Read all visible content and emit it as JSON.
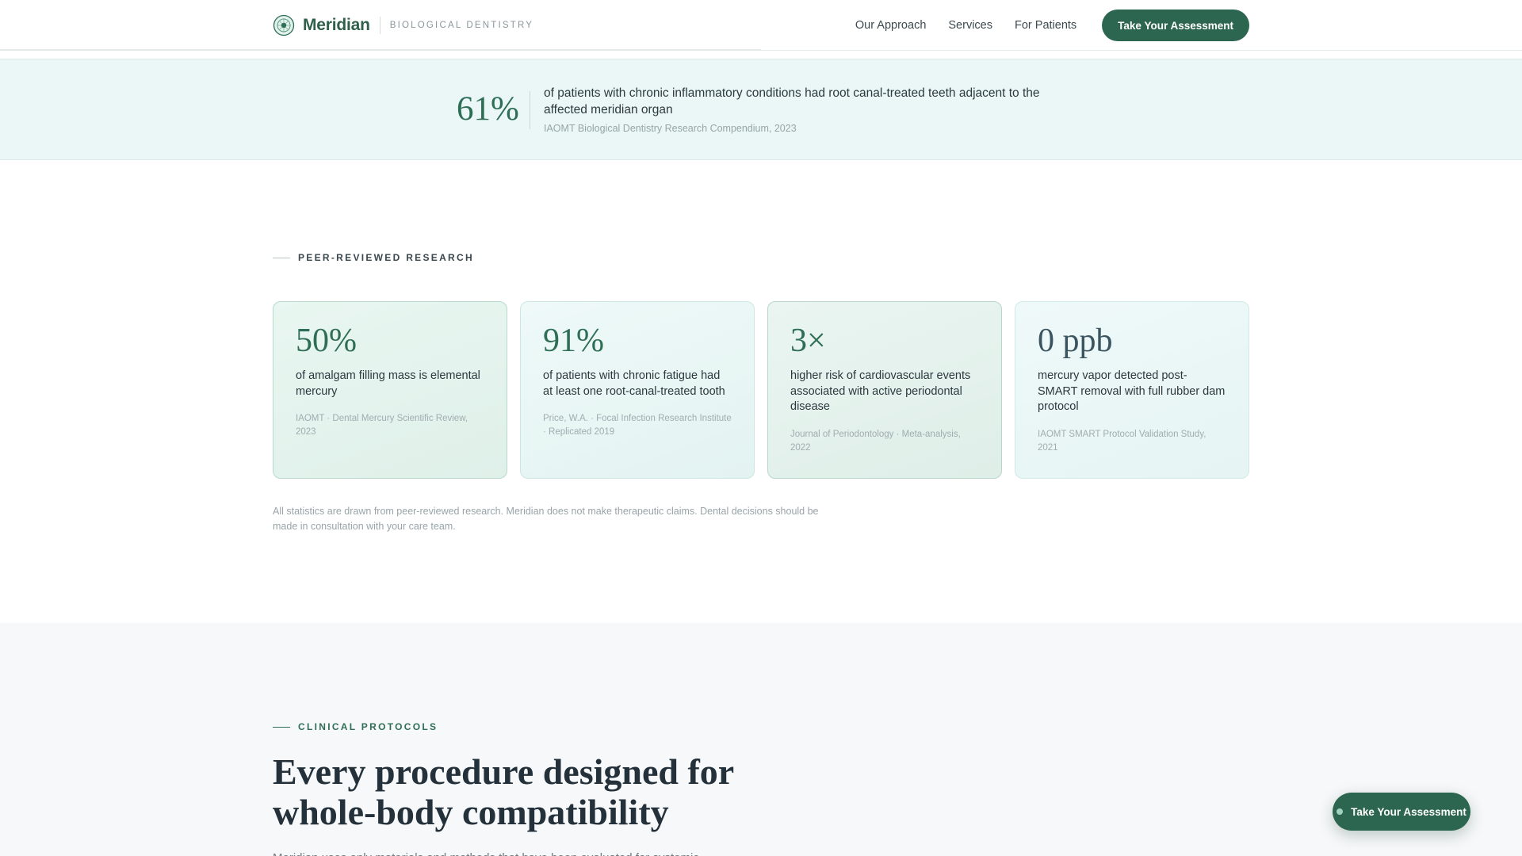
{
  "colors": {
    "brand": "#2f5e4b",
    "accent": "#2c6550",
    "banner_bg": "#eaf7f6",
    "section_bg": "#f6f8f9"
  },
  "header": {
    "logo_icon": "meridian-logo-icon",
    "brand_name": "Meridian",
    "brand_tagline": "BIOLOGICAL DENTISTRY",
    "nav": [
      "Our Approach",
      "Services",
      "For Patients"
    ],
    "cta_label": "Take Your Assessment"
  },
  "banner": {
    "value": "61%",
    "text": "of patients with chronic inflammatory conditions had root canal-treated teeth adjacent to the affected meridian organ",
    "source": "IAOMT Biological Dentistry Research Compendium, 2023"
  },
  "research": {
    "eyebrow": "PEER-REVIEWED RESEARCH",
    "cards": [
      {
        "value": "50%",
        "description": "of amalgam filling mass is elemental mercury",
        "source": "IAOMT · Dental Mercury Scientific Review, 2023"
      },
      {
        "value": "91%",
        "description": "of patients with chronic fatigue had at least one root-canal-treated tooth",
        "source": "Price, W.A. · Focal Infection Research Institute · Replicated 2019"
      },
      {
        "value": "3×",
        "description": "higher risk of cardiovascular events associated with active periodontal disease",
        "source": "Journal of Periodontology · Meta-analysis, 2022"
      },
      {
        "value": "0 ppb",
        "description": "mercury vapor detected post-SMART removal with full rubber dam protocol",
        "source": "IAOMT SMART Protocol Validation Study, 2021"
      }
    ],
    "disclaimer": "All statistics are drawn from peer-reviewed research. Meridian does not make therapeutic claims. Dental decisions should be made in consultation with your care team."
  },
  "protocols": {
    "eyebrow": "CLINICAL PROTOCOLS",
    "title": "Every procedure designed for whole-body compatibility",
    "lead": "Meridian uses only materials and methods that have been evaluated for systemic"
  },
  "floating_cta": {
    "label": "Take Your Assessment"
  }
}
